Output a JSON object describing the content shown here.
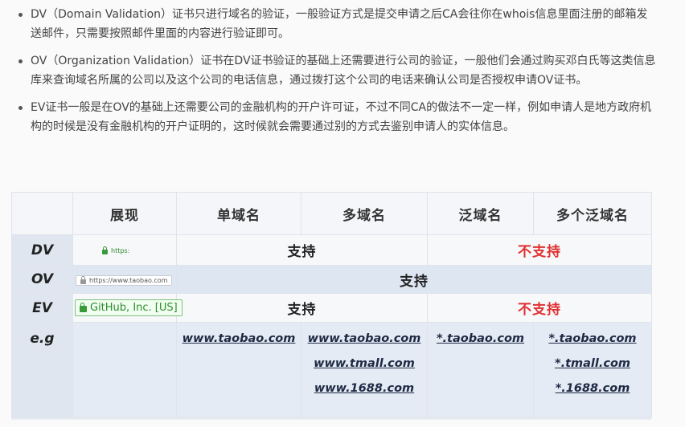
{
  "bullets": [
    {
      "text": "DV（Domain Validation）证书只进行域名的验证，一般验证方式是提交申请之后CA会往你在whois信息里面注册的邮箱发送邮件，只需要按照邮件里面的内容进行验证即可。"
    },
    {
      "text": "OV（Organization Validation）证书在DV证书验证的基础上还需要进行公司的验证，一般他们会通过购买邓白氏等这类信息库来查询域名所属的公司以及这个公司的电话信息，通过拨打这个公司的电话来确认公司是否授权申请OV证书。"
    },
    {
      "text": "EV证书一般是在OV的基础上还需要公司的金融机构的开户许可证，不过不同CA的做法不一定一样，例如申请人是地方政府机构的时候是没有金融机构的开户证明的，这时候就会需要通过别的方式去鉴别申请人的实体信息。"
    }
  ],
  "table": {
    "headers": [
      "",
      "展现",
      "单域名",
      "多域名",
      "泛域名",
      "多个泛域名"
    ],
    "rows": {
      "dv": {
        "label": "DV",
        "badge": "https:",
        "support": "支持",
        "nosupport": "不支持"
      },
      "ov": {
        "label": "OV",
        "badge": "https://www.taobao.com",
        "support": "支持"
      },
      "ev": {
        "label": "EV",
        "badge": "GitHub, Inc. [US]",
        "support": "支持",
        "nosupport": "不支持"
      },
      "eg": {
        "label": "e.g",
        "single": [
          "www.taobao.com"
        ],
        "multi": [
          "www.taobao.com",
          "www.tmall.com",
          "www.1688.com"
        ],
        "wildcard": [
          "*.taobao.com"
        ],
        "multi_wildcard": [
          "*.taobao.com",
          "*.tmall.com",
          "*.1688.com"
        ]
      }
    }
  },
  "colors": {
    "nosupport": "#e03030",
    "lock": "#3a9a3a"
  },
  "icons": [
    "lock-icon"
  ]
}
